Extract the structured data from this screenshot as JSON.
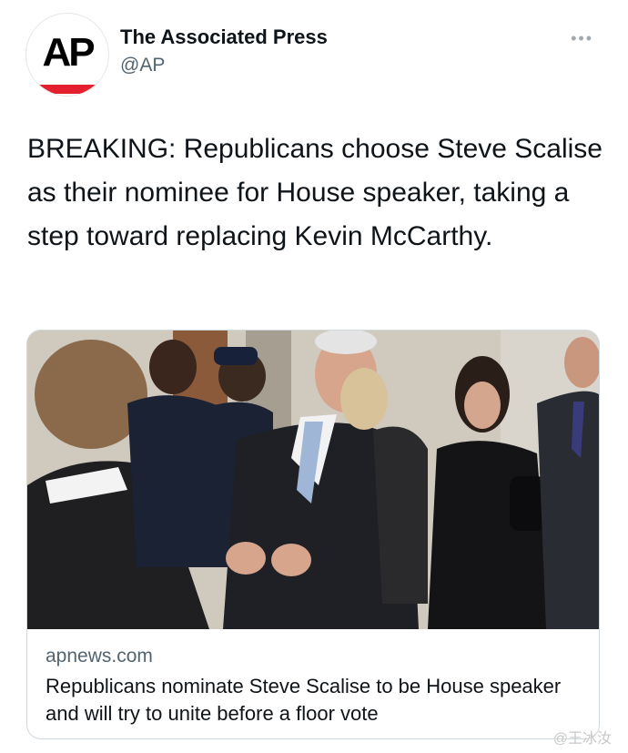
{
  "account": {
    "avatar_logo": "AP",
    "display_name": "The Associated Press",
    "handle": "@AP"
  },
  "tweet": {
    "text": "BREAKING: Republicans choose Steve Scalise as their nominee for House speaker, taking a step toward replacing Kevin McCarthy."
  },
  "card": {
    "domain": "apnews.com",
    "title": "Republicans nominate Steve Scalise to be House speaker and will try to unite before a floor vote"
  },
  "overlay": {
    "watermark": "@王冰汝"
  },
  "icons": {
    "more": "more-options-icon"
  },
  "colors": {
    "text_primary": "#0f1419",
    "text_secondary": "#536471",
    "ap_red": "#e5202e",
    "card_border": "#cfd9de"
  }
}
